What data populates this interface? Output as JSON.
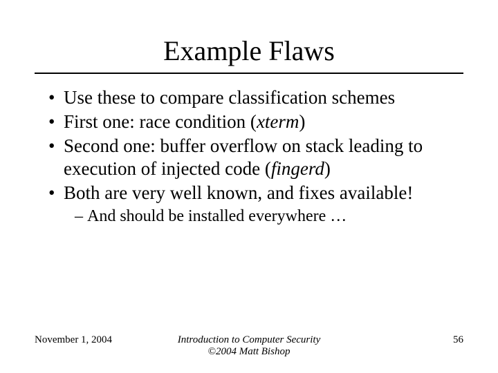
{
  "title": "Example Flaws",
  "bullets": {
    "b1": "Use these to compare classification schemes",
    "b2_pre": "First one: race condition (",
    "b2_it": "xterm",
    "b2_post": ")",
    "b3_pre": "Second one: buffer overflow on stack leading to execution of injected code (",
    "b3_it": "fingerd",
    "b3_post": ")",
    "b4": "Both are very well known, and fixes available!"
  },
  "sub": {
    "s1": "And should be installed everywhere …"
  },
  "footer": {
    "date": "November 1, 2004",
    "center_line1": "Introduction to Computer Security",
    "center_line2": "©2004 Matt Bishop",
    "page": "56"
  }
}
